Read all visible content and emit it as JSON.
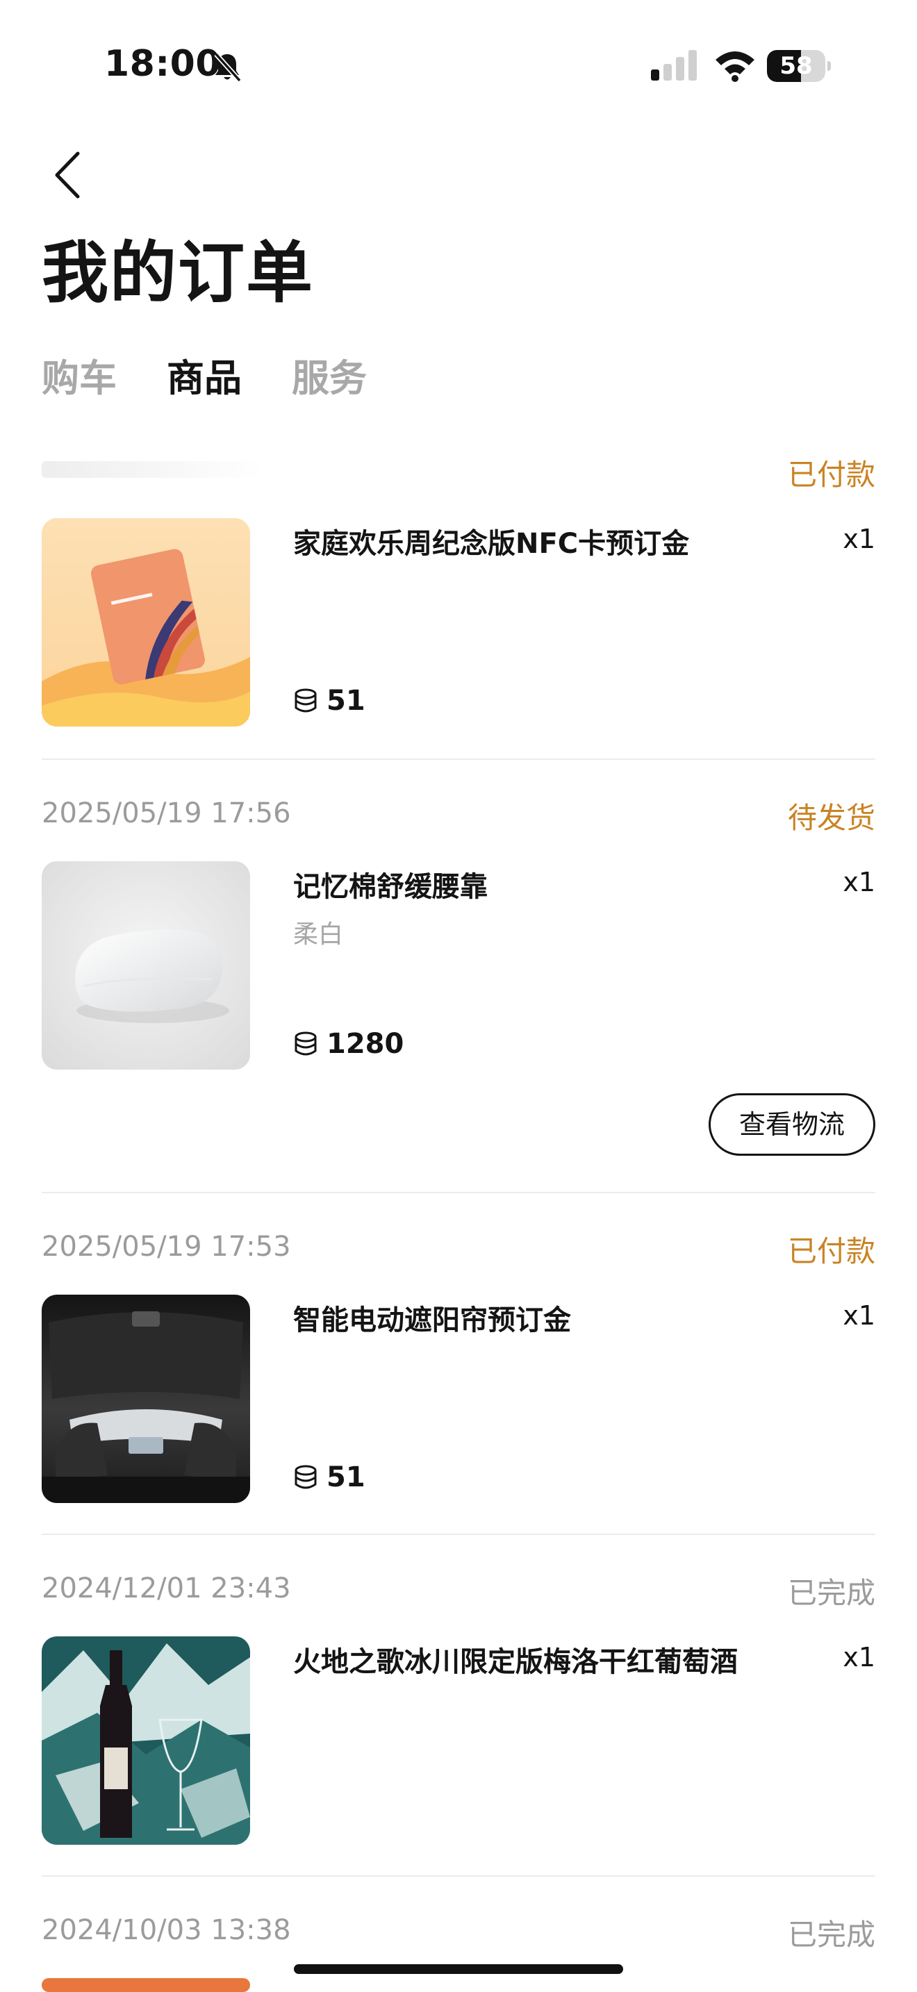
{
  "status_bar": {
    "time": "18:00",
    "battery": "58",
    "battery_level": 0.58,
    "icons": [
      "bell-slash-icon",
      "signal-icon",
      "wifi-icon",
      "battery-icon"
    ]
  },
  "header": {
    "back_icon": "chevron-left-icon",
    "title": "我的订单"
  },
  "tabs": [
    {
      "label": "购车",
      "active": false
    },
    {
      "label": "商品",
      "active": true
    },
    {
      "label": "服务",
      "active": false
    }
  ],
  "orders": [
    {
      "date": "",
      "status": "已付款",
      "product": "家庭欢乐周纪念版NFC卡预订金",
      "variant": "",
      "qty": "x1",
      "price": "51",
      "thumb": "nfc-card-image"
    },
    {
      "date": "2025/05/19 17:56",
      "status": "待发货",
      "product": "记忆棉舒缓腰靠",
      "variant": "柔白",
      "qty": "x1",
      "price": "1280",
      "action": "查看物流",
      "thumb": "lumbar-pillow-image"
    },
    {
      "date": "2025/05/19 17:53",
      "status": "已付款",
      "product": "智能电动遮阳帘预订金",
      "variant": "",
      "qty": "x1",
      "price": "51",
      "thumb": "car-sunshade-image"
    },
    {
      "date": "2024/12/01 23:43",
      "status": "已完成",
      "product": "火地之歌冰川限定版梅洛干红葡萄酒",
      "variant": "",
      "qty": "x1",
      "price": "",
      "thumb": "wine-bottle-image"
    },
    {
      "date": "2024/10/03 13:38",
      "status": "已完成"
    }
  ],
  "colors": {
    "status_accent": "#c98324",
    "status_muted": "#9b9b9b",
    "text_primary": "#141414",
    "tab_inactive": "#a8a8a8"
  }
}
